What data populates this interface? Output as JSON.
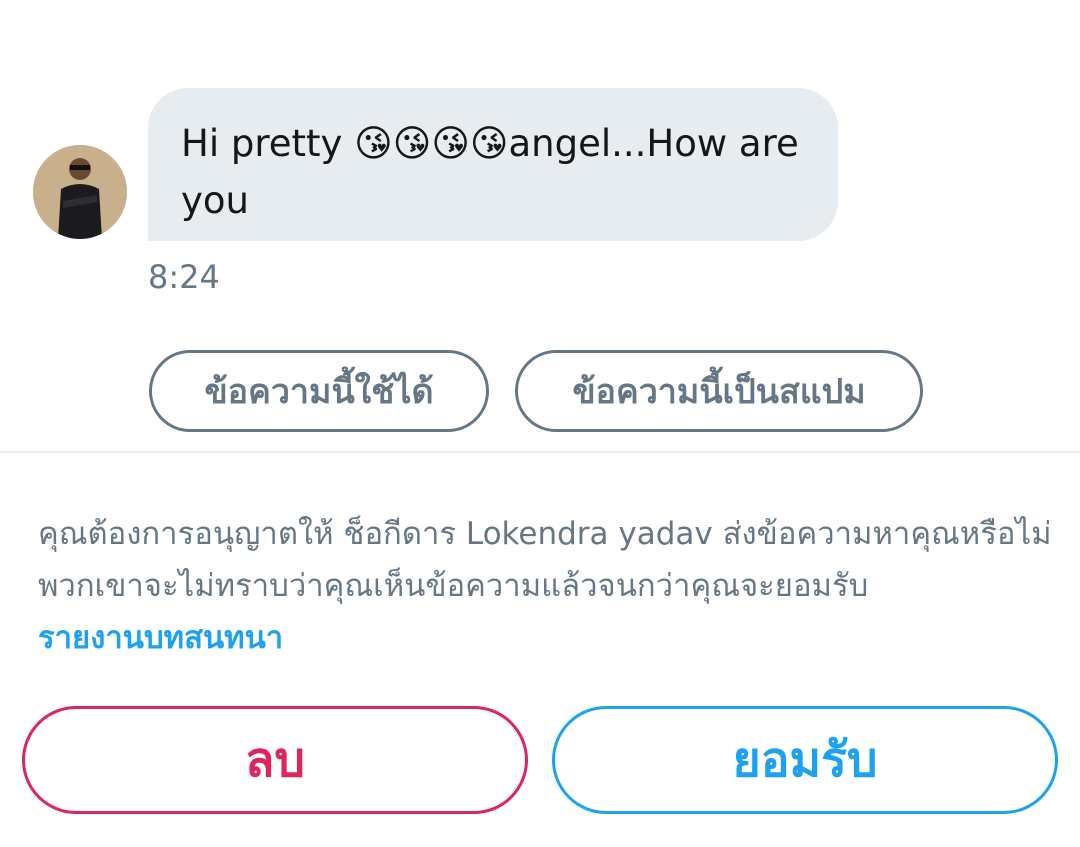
{
  "conversation": {
    "message_text": "Hi pretty 😘😘😘😘angel...How are you",
    "timestamp": "8:24"
  },
  "spam_options": {
    "ok_label": "ข้อความนี้ใช้ได้",
    "spam_label": "ข้อความนี้เป็นสแปม"
  },
  "request": {
    "prompt": "คุณต้องการอนุญาตให้ ช็อกีดาร Lokendra yadav ส่งข้อความหาคุณหรือไม่ พวกเขาจะไม่ทราบว่าคุณเห็นข้อความแล้วจนกว่าคุณจะยอมรับ",
    "report_link": "รายงานบทสนทนา"
  },
  "actions": {
    "delete_label": "ลบ",
    "accept_label": "ยอมรับ"
  },
  "colors": {
    "bubble_bg": "#e6ecf0",
    "text_secondary": "#657786",
    "link": "#1da1f2",
    "delete": "#e0245e",
    "accept": "#1da1f2"
  },
  "icons": {
    "avatar": "user-avatar-photo"
  }
}
